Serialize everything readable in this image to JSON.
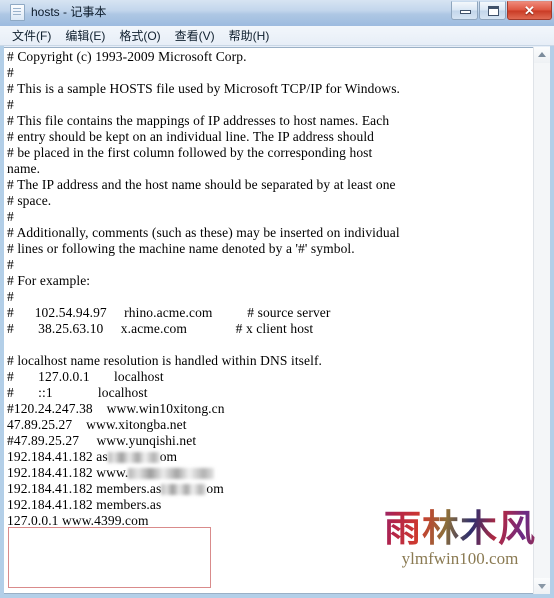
{
  "window": {
    "title": "hosts - 记事本",
    "icon": "notepad-document-icon",
    "buttons": {
      "minimize": "最小化",
      "maximize": "最大化",
      "close": "✕"
    }
  },
  "menubar": {
    "items": [
      {
        "label": "文件(F)"
      },
      {
        "label": "编辑(E)"
      },
      {
        "label": "格式(O)"
      },
      {
        "label": "查看(V)"
      },
      {
        "label": "帮助(H)"
      }
    ]
  },
  "editor": {
    "lines": [
      "# Copyright (c) 1993-2009 Microsoft Corp.",
      "#",
      "# This is a sample HOSTS file used by Microsoft TCP/IP for Windows.",
      "#",
      "# This file contains the mappings of IP addresses to host names. Each",
      "# entry should be kept on an individual line. The IP address should",
      "# be placed in the first column followed by the corresponding host",
      "name.",
      "# The IP address and the host name should be separated by at least one",
      "# space.",
      "#",
      "# Additionally, comments (such as these) may be inserted on individual",
      "# lines or following the machine name denoted by a '#' symbol.",
      "#",
      "# For example:",
      "#",
      "#      102.54.94.97     rhino.acme.com          # source server",
      "#       38.25.63.10     x.acme.com              # x client host",
      "",
      "# localhost name resolution is handled within DNS itself.",
      "#       127.0.0.1       localhost",
      "#       ::1             localhost",
      "#120.24.247.38    www.win10xitong.cn",
      "47.89.25.27    www.xitongba.net",
      "#47.89.25.27     www.yunqishi.net",
      "",
      "192.184.41.182 as",
      "192.184.41.182 www.",
      "192.184.41.182 members.as",
      "127.0.0.1 www.4399.com"
    ],
    "redacted_lines": [
      {
        "index": 25,
        "prefix": "192.184.41.182 as",
        "suffix": "om",
        "blur_width": 52
      },
      {
        "index": 26,
        "prefix": "192.184.41.182 www.",
        "suffix": "",
        "blur_width": 86
      },
      {
        "index": 27,
        "prefix": "192.184.41.182 members.as",
        "suffix": "om",
        "blur_width": 45
      }
    ],
    "highlighted_entry": "127.0.0.1 www.4399.com"
  },
  "annotation": {
    "type": "red-rectangle",
    "color": "#d98b8b",
    "targets_line": "127.0.0.1 www.4399.com"
  },
  "scrollbar": {
    "up_arrow": "▲",
    "down_arrow": "▼"
  },
  "watermark": {
    "brand_cn": "雨林木风",
    "url": "ylmfwin100.com"
  }
}
